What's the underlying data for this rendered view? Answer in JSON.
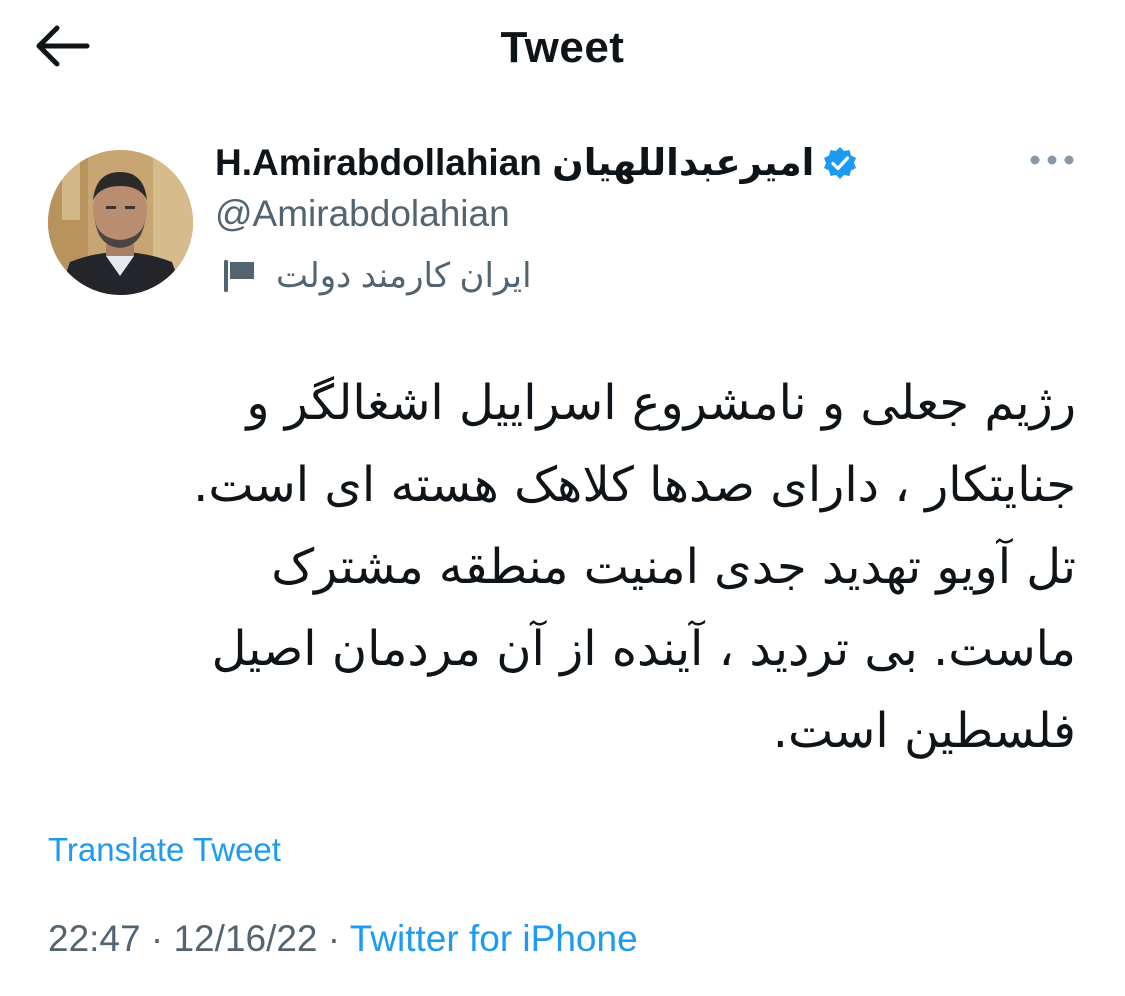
{
  "header": {
    "title": "Tweet",
    "back_icon": "arrow-left-icon"
  },
  "author": {
    "display_name": "H.Amirabdollahian امیرعبداللهیان",
    "handle": "@Amirabdolahian",
    "verified": true,
    "verified_color": "#1d9bf0",
    "label_text": "ایران کارمند دولت",
    "label_icon": "flag-icon",
    "avatar_icon": "avatar"
  },
  "menu": {
    "more_icon": "more-horizontal-icon"
  },
  "tweet": {
    "lines": [
      "رژیم جعلی و نامشروع اسراییل اشغالگر و",
      "جنایتکار ، دارای صدها کلاهک هسته ای است.",
      "تل آویو تهدید جدی امنیت منطقه مشترک",
      "ماست. بی تردید ، آینده از آن مردمان اصیل",
      "فلسطین است."
    ],
    "translate_label": "Translate Tweet"
  },
  "meta": {
    "time": "22:47",
    "separator": " · ",
    "date": "12/16/22",
    "source": "Twitter for iPhone"
  },
  "colors": {
    "text": "#0f1419",
    "secondary": "#536471",
    "link": "#1d9bf0"
  }
}
